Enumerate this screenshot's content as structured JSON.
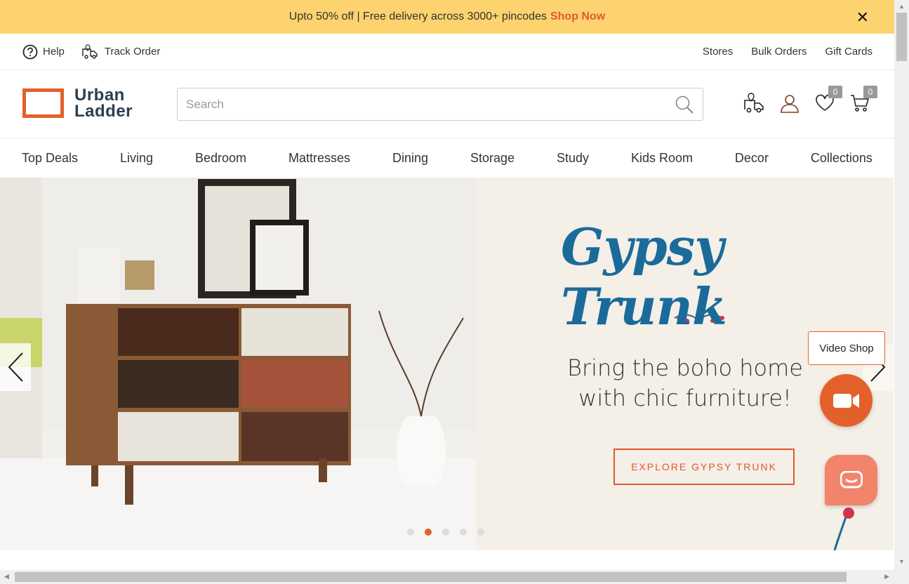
{
  "promo": {
    "text": "Upto 50% off | Free delivery across 3000+ pincodes",
    "cta": "Shop Now",
    "close": "✕"
  },
  "util": {
    "help": "Help",
    "track": "Track Order",
    "links": [
      "Stores",
      "Bulk Orders",
      "Gift Cards"
    ]
  },
  "header": {
    "logo_line1": "Urban",
    "logo_line2": "Ladder",
    "search_placeholder": "Search",
    "wishlist_count": "0",
    "cart_count": "0"
  },
  "nav": [
    "Top Deals",
    "Living",
    "Bedroom",
    "Mattresses",
    "Dining",
    "Storage",
    "Study",
    "Kids Room",
    "Decor",
    "Collections"
  ],
  "hero": {
    "brand": "Gypsy Trunk",
    "tagline_line1": "Bring the boho home",
    "tagline_line2": "with chic furniture!",
    "cta": "EXPLORE GYPSY TRUNK",
    "slide_count": 5,
    "active_slide": 2
  },
  "floating": {
    "video_label": "Video Shop"
  },
  "colors": {
    "accent": "#e4602b",
    "promo_bg": "#fcd36e",
    "brand_blue": "#1a6b9a"
  }
}
